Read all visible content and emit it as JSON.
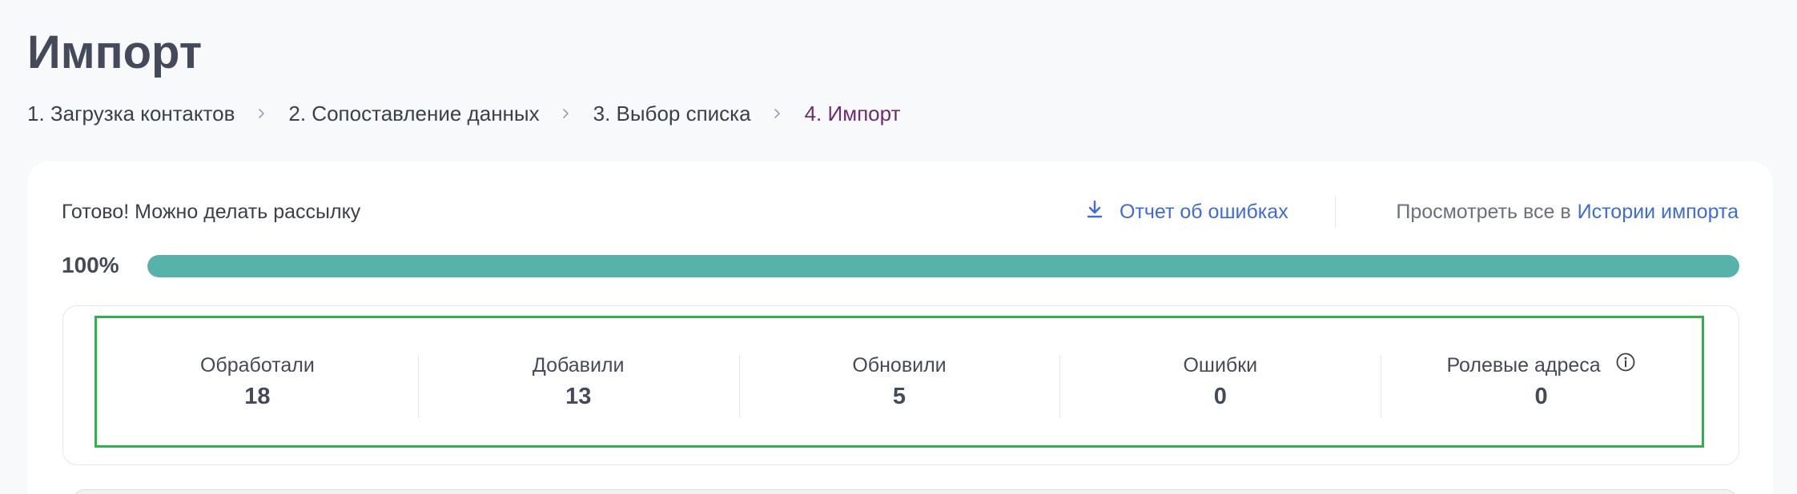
{
  "page": {
    "title": "Импорт"
  },
  "steps": [
    {
      "label": "1. Загрузка контактов"
    },
    {
      "label": "2. Сопоставление данных"
    },
    {
      "label": "3. Выбор списка"
    },
    {
      "label": "4. Импорт"
    }
  ],
  "status": {
    "text": "Готово! Можно делать рассылку",
    "report_link": "Отчет об ошибках",
    "history_prefix": "Просмотреть все в",
    "history_link": "Истории импорта"
  },
  "progress": {
    "label": "100%",
    "value": 100
  },
  "stats": [
    {
      "label": "Обработали",
      "value": "18"
    },
    {
      "label": "Добавили",
      "value": "13"
    },
    {
      "label": "Обновили",
      "value": "5"
    },
    {
      "label": "Ошибки",
      "value": "0"
    },
    {
      "label": "Ролевые адреса",
      "value": "0"
    }
  ],
  "colors": {
    "accent_link": "#3f6bd9",
    "active_step": "#6d2e6f",
    "progress_fill": "#57b3aa",
    "highlight_border": "#2db24c"
  },
  "icons": {
    "step_separator": "chevron-right-icon",
    "report": "download-icon",
    "role_info": "info-icon"
  }
}
